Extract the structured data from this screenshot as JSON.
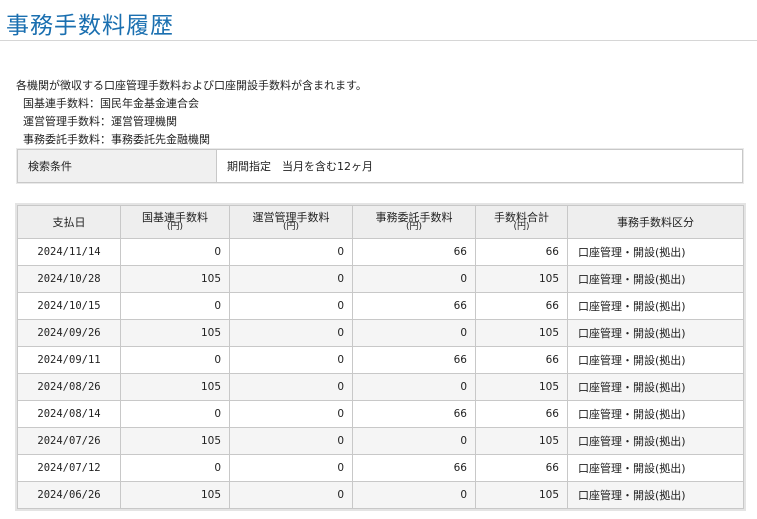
{
  "page": {
    "title": "事務手数料履歴"
  },
  "notes": {
    "intro": "各機関が徴収する口座管理手数料および口座開設手数料が含まれます。",
    "line1": "国基連手数料：国民年金基金連合会",
    "line2": "運営管理手数料：運営管理機関",
    "line3": "事務委託手数料：事務委託先金融機関"
  },
  "search": {
    "label": "検索条件",
    "value": "期間指定　当月を含む12ヶ月"
  },
  "table": {
    "headers": {
      "date": "支払日",
      "kokkiren": "国基連手数料",
      "kokkiren_unit": "(円)",
      "unei": "運営管理手数料",
      "unei_unit": "(円)",
      "jimu": "事務委託手数料",
      "jimu_unit": "(円)",
      "total": "手数料合計",
      "total_unit": "(円)",
      "category": "事務手数料区分"
    },
    "rows": [
      {
        "date": "2024/11/14",
        "kokkiren": "0",
        "unei": "0",
        "jimu": "66",
        "total": "66",
        "category": "口座管理・開設(拠出)"
      },
      {
        "date": "2024/10/28",
        "kokkiren": "105",
        "unei": "0",
        "jimu": "0",
        "total": "105",
        "category": "口座管理・開設(拠出)"
      },
      {
        "date": "2024/10/15",
        "kokkiren": "0",
        "unei": "0",
        "jimu": "66",
        "total": "66",
        "category": "口座管理・開設(拠出)"
      },
      {
        "date": "2024/09/26",
        "kokkiren": "105",
        "unei": "0",
        "jimu": "0",
        "total": "105",
        "category": "口座管理・開設(拠出)"
      },
      {
        "date": "2024/09/11",
        "kokkiren": "0",
        "unei": "0",
        "jimu": "66",
        "total": "66",
        "category": "口座管理・開設(拠出)"
      },
      {
        "date": "2024/08/26",
        "kokkiren": "105",
        "unei": "0",
        "jimu": "0",
        "total": "105",
        "category": "口座管理・開設(拠出)"
      },
      {
        "date": "2024/08/14",
        "kokkiren": "0",
        "unei": "0",
        "jimu": "66",
        "total": "66",
        "category": "口座管理・開設(拠出)"
      },
      {
        "date": "2024/07/26",
        "kokkiren": "105",
        "unei": "0",
        "jimu": "0",
        "total": "105",
        "category": "口座管理・開設(拠出)"
      },
      {
        "date": "2024/07/12",
        "kokkiren": "0",
        "unei": "0",
        "jimu": "66",
        "total": "66",
        "category": "口座管理・開設(拠出)"
      },
      {
        "date": "2024/06/26",
        "kokkiren": "105",
        "unei": "0",
        "jimu": "0",
        "total": "105",
        "category": "口座管理・開設(拠出)"
      }
    ]
  }
}
